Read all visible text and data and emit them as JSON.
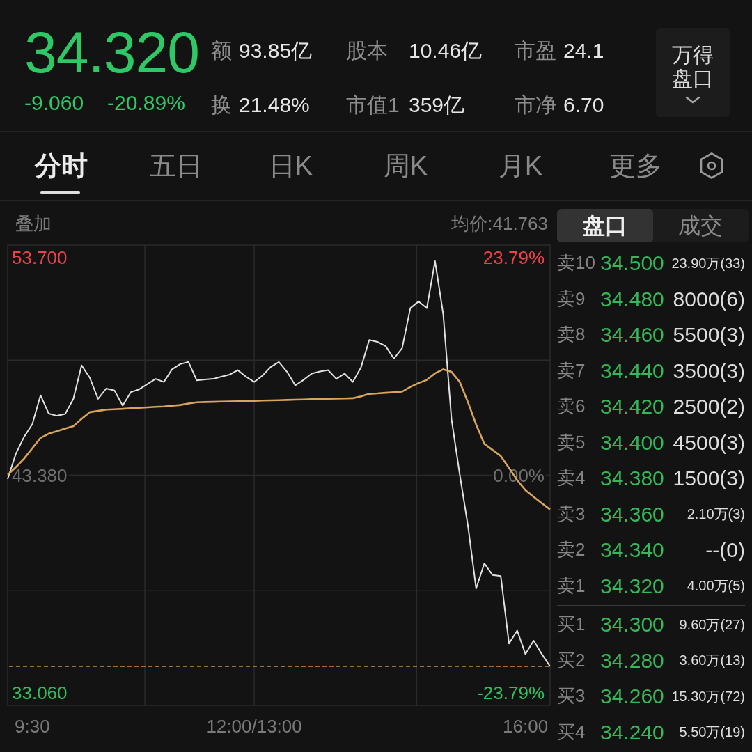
{
  "quote": {
    "price": "34.320",
    "change": "-9.060",
    "change_percent": "-20.89%",
    "down": true
  },
  "stats": [
    {
      "label": "额",
      "value": "93.85亿"
    },
    {
      "label": "股本",
      "value": "10.46亿"
    },
    {
      "label": "市盈",
      "value": "24.1"
    },
    {
      "label": "换",
      "value": "21.48%"
    },
    {
      "label": "市值1",
      "value": "359亿"
    },
    {
      "label": "市净",
      "value": "6.70"
    }
  ],
  "panel_button": {
    "label": "万得盘口"
  },
  "tabs": [
    {
      "label": "分时",
      "selected": true
    },
    {
      "label": "五日",
      "selected": false
    },
    {
      "label": "日K",
      "selected": false
    },
    {
      "label": "周K",
      "selected": false
    },
    {
      "label": "月K",
      "selected": false
    },
    {
      "label": "更多",
      "selected": false
    }
  ],
  "chart": {
    "overlay_label": "叠加",
    "average_label": "均价:41.763",
    "percent_labels": [
      "23.79%",
      "0.00%",
      "-23.79%"
    ],
    "chart_data": {
      "type": "line",
      "categories": [
        null,
        null,
        null,
        "9:30",
        null,
        null,
        null,
        null,
        null,
        null,
        null,
        null,
        null,
        null,
        null,
        null,
        null,
        null,
        null,
        null,
        null,
        null,
        null,
        null,
        null,
        null,
        null,
        null,
        null,
        null,
        "12:00/13:00",
        null,
        null,
        null,
        null,
        null,
        null,
        null,
        null,
        null,
        null,
        null,
        null,
        null,
        null,
        null,
        null,
        null,
        null,
        null,
        null,
        null,
        null,
        null,
        null,
        null,
        null,
        null,
        null,
        null,
        null,
        null,
        null,
        "16:00",
        null,
        null,
        null
      ],
      "series": [
        {
          "color": "#e2e2e2",
          "values": [
            43.2,
            44.4,
            45.2,
            45.8,
            47.17,
            46.3,
            46.2,
            46.28,
            47.0,
            48.59,
            48.0,
            47.0,
            47.49,
            47.4,
            46.68,
            47.32,
            47.45,
            47.7,
            47.95,
            47.8,
            48.4,
            48.65,
            48.75,
            47.88,
            47.92,
            47.95,
            48.05,
            48.15,
            48.36,
            48.05,
            47.8,
            48.1,
            48.51,
            48.75,
            48.28,
            47.64,
            47.9,
            48.2,
            48.3,
            48.36,
            47.95,
            48.2,
            47.8,
            48.5,
            49.79,
            49.7,
            49.5,
            48.91,
            49.4,
            51.3,
            51.62,
            51.3,
            53.53,
            51.0,
            46.05,
            43.43,
            41.0,
            38.01,
            39.2,
            38.65,
            38.6,
            35.4,
            36.02,
            34.9,
            35.54,
            34.9,
            34.32
          ]
        },
        {
          "color": "#d9a45e",
          "values": [
            43.4,
            43.76,
            44.17,
            44.66,
            45.15,
            45.35,
            45.47,
            45.59,
            45.71,
            46.05,
            46.37,
            46.43,
            46.49,
            46.51,
            46.53,
            46.56,
            46.58,
            46.6,
            46.62,
            46.64,
            46.67,
            46.71,
            46.78,
            46.84,
            46.85,
            46.86,
            46.87,
            46.88,
            46.89,
            46.9,
            46.91,
            46.92,
            46.93,
            46.94,
            46.95,
            46.96,
            46.97,
            46.98,
            46.99,
            47.0,
            47.01,
            47.02,
            47.03,
            47.12,
            47.24,
            47.26,
            47.29,
            47.31,
            47.34,
            47.57,
            47.75,
            47.9,
            48.21,
            48.4,
            48.28,
            47.81,
            46.85,
            45.78,
            44.87,
            44.58,
            44.29,
            43.73,
            43.15,
            42.67,
            42.36,
            42.05,
            41.76
          ]
        }
      ],
      "ylim": [
        32.47,
        54.29
      ],
      "yticks": [
        {
          "value": 53.7,
          "label": "53.700"
        },
        {
          "value": 43.38,
          "label": "43.380"
        },
        {
          "value": 33.06,
          "label": "33.060"
        }
      ],
      "ref_lines": [
        {
          "axis": "y",
          "value": 34.32,
          "color": "#d08a4b"
        }
      ]
    }
  },
  "order_book": {
    "tabs": [
      {
        "label": "盘口",
        "selected": true
      },
      {
        "label": "成交",
        "selected": false
      }
    ],
    "asks": [
      {
        "level": "卖10",
        "price": "34.500",
        "volume": "23.90万(33)"
      },
      {
        "level": "卖9",
        "price": "34.480",
        "volume": "8000(6)"
      },
      {
        "level": "卖8",
        "price": "34.460",
        "volume": "5500(3)"
      },
      {
        "level": "卖7",
        "price": "34.440",
        "volume": "3500(3)"
      },
      {
        "level": "卖6",
        "price": "34.420",
        "volume": "2500(2)"
      },
      {
        "level": "卖5",
        "price": "34.400",
        "volume": "4500(3)"
      },
      {
        "level": "卖4",
        "price": "34.380",
        "volume": "1500(3)"
      },
      {
        "level": "卖3",
        "price": "34.360",
        "volume": "2.10万(3)"
      },
      {
        "level": "卖2",
        "price": "34.340",
        "volume": "--(0)"
      },
      {
        "level": "卖1",
        "price": "34.320",
        "volume": "4.00万(5)"
      }
    ],
    "bids": [
      {
        "level": "买1",
        "price": "34.300",
        "volume": "9.60万(27)"
      },
      {
        "level": "买2",
        "price": "34.280",
        "volume": "3.60万(13)"
      },
      {
        "level": "买3",
        "price": "34.260",
        "volume": "15.30万(72)"
      },
      {
        "level": "买4",
        "price": "34.240",
        "volume": "5.50万(19)"
      }
    ]
  }
}
